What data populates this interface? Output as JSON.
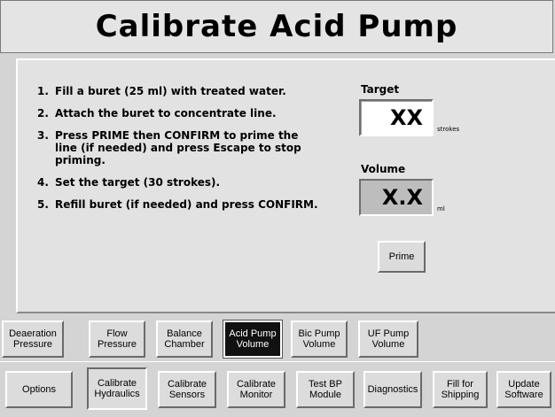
{
  "title": "Calibrate Acid Pump",
  "steps": [
    {
      "num": "1.",
      "text": "Fill a buret (25 ml) with treated water."
    },
    {
      "num": "2.",
      "text": "Attach the buret to concentrate line."
    },
    {
      "num": "3.",
      "text": "Press PRIME then CONFIRM to prime the line (if needed) and press Escape to stop priming."
    },
    {
      "num": "4.",
      "text": "Set the target (30 strokes)."
    },
    {
      "num": "5.",
      "text": "Refill buret (if needed) and press CONFIRM."
    }
  ],
  "target": {
    "label": "Target",
    "value": "XX",
    "unit": "strokes"
  },
  "volume": {
    "label": "Volume",
    "value": "X.X",
    "unit": "ml"
  },
  "prime_label": "Prime",
  "calibration_tabs": [
    {
      "label": "Deaeration Pressure"
    },
    {
      "label": "Flow Pressure"
    },
    {
      "label": "Balance Chamber"
    },
    {
      "label": "Acid Pump Volume"
    },
    {
      "label": "Bic Pump Volume"
    },
    {
      "label": "UF Pump Volume"
    }
  ],
  "menu_tabs": [
    {
      "label": "Options"
    },
    {
      "label": "Calibrate Hydraulics"
    },
    {
      "label": "Calibrate Sensors"
    },
    {
      "label": "Calibrate Monitor"
    },
    {
      "label": "Test BP Module"
    },
    {
      "label": "Diagnostics"
    },
    {
      "label": "Fill for Shipping"
    },
    {
      "label": "Update Software"
    }
  ]
}
